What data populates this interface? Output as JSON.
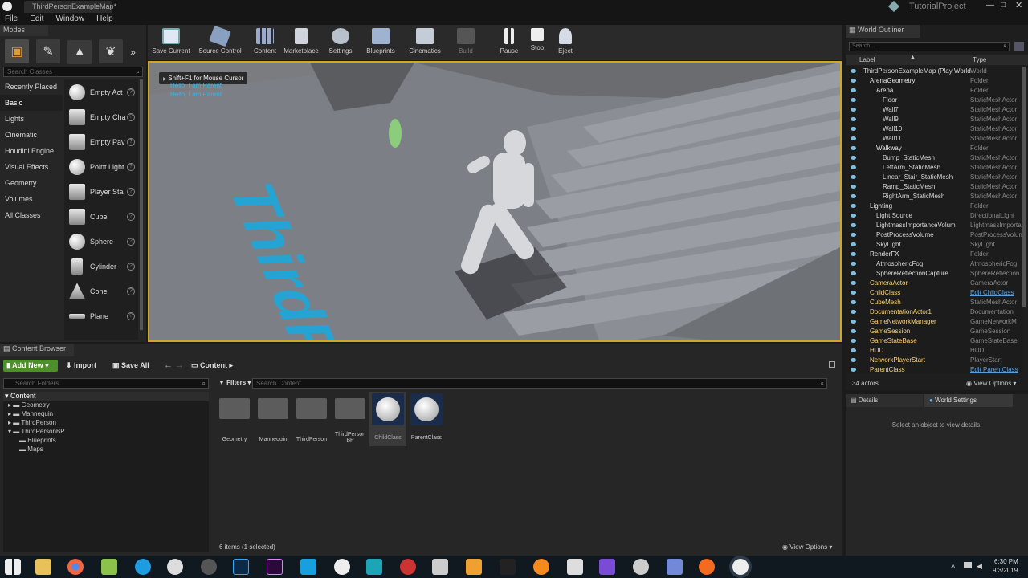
{
  "titlebar": {
    "tab_label": "ThirdPersonExampleMap*",
    "project_name": "TutorialProject"
  },
  "menu": [
    "File",
    "Edit",
    "Window",
    "Help"
  ],
  "modes": {
    "tab_label": "Modes",
    "search_placeholder": "Search Classes",
    "categories": [
      "Recently Placed",
      "Basic",
      "Lights",
      "Cinematic",
      "Houdini Engine",
      "Visual Effects",
      "Geometry",
      "Volumes",
      "All Classes"
    ],
    "selected_category": "Basic",
    "items": [
      "Empty Act",
      "Empty Cha",
      "Empty Pav",
      "Point Light",
      "Player Sta",
      "Cube",
      "Sphere",
      "Cylinder",
      "Cone",
      "Plane"
    ]
  },
  "toolbar": {
    "buttons": [
      "Save Current",
      "Source Control",
      "Content",
      "Marketplace",
      "Settings",
      "Blueprints",
      "Cinematics",
      "Build",
      "Pause",
      "Stop",
      "Eject"
    ]
  },
  "viewport": {
    "hint": "Shift+F1 for Mouse Cursor",
    "log_line_1": "Hello, I am Parent",
    "log_line_2": "Hello, I am Parent",
    "floor_text": "ThirdPerson"
  },
  "content_browser": {
    "tab_label": "Content Browser",
    "add_new": "Add New",
    "import": "Import",
    "save_all": "Save All",
    "path": "Content",
    "search_folders_placeholder": "Search Folders",
    "filters": "Filters",
    "search_content_placeholder": "Search Content",
    "tree": [
      "Content",
      "Geometry",
      "Mannequin",
      "ThirdPerson",
      "ThirdPersonBP",
      "Blueprints",
      "Maps"
    ],
    "assets": [
      "Geometry",
      "Mannequin",
      "ThirdPerson",
      "ThirdPerson BP",
      "ChildClass",
      "ParentClass"
    ],
    "status": "6 items (1 selected)",
    "view_options": "View Options"
  },
  "world_outliner": {
    "tab_label": "World Outliner",
    "search_placeholder": "Search...",
    "col_label": "Label",
    "col_type": "Type",
    "rows": [
      {
        "label": "ThirdPersonExampleMap (Play World",
        "type": "World",
        "indent": 0
      },
      {
        "label": "ArenaGeometry",
        "type": "Folder",
        "indent": 1
      },
      {
        "label": "Arena",
        "type": "Folder",
        "indent": 2
      },
      {
        "label": "Floor",
        "type": "StaticMeshActor",
        "indent": 3
      },
      {
        "label": "Wall7",
        "type": "StaticMeshActor",
        "indent": 3
      },
      {
        "label": "Wall9",
        "type": "StaticMeshActor",
        "indent": 3
      },
      {
        "label": "Wall10",
        "type": "StaticMeshActor",
        "indent": 3
      },
      {
        "label": "Wall11",
        "type": "StaticMeshActor",
        "indent": 3
      },
      {
        "label": "Walkway",
        "type": "Folder",
        "indent": 2
      },
      {
        "label": "Bump_StaticMesh",
        "type": "StaticMeshActor",
        "indent": 3
      },
      {
        "label": "LeftArm_StaticMesh",
        "type": "StaticMeshActor",
        "indent": 3
      },
      {
        "label": "Linear_Stair_StaticMesh",
        "type": "StaticMeshActor",
        "indent": 3
      },
      {
        "label": "Ramp_StaticMesh",
        "type": "StaticMeshActor",
        "indent": 3
      },
      {
        "label": "RightArm_StaticMesh",
        "type": "StaticMeshActor",
        "indent": 3
      },
      {
        "label": "Lighting",
        "type": "Folder",
        "indent": 1
      },
      {
        "label": "Light Source",
        "type": "DirectionalLight",
        "indent": 2
      },
      {
        "label": "LightmassImportanceVolum",
        "type": "LightmassImportance",
        "indent": 2
      },
      {
        "label": "PostProcessVolume",
        "type": "PostProcessVolume",
        "indent": 2
      },
      {
        "label": "SkyLight",
        "type": "SkyLight",
        "indent": 2
      },
      {
        "label": "RenderFX",
        "type": "Folder",
        "indent": 1
      },
      {
        "label": "AtmosphericFog",
        "type": "AtmosphericFog",
        "indent": 2
      },
      {
        "label": "SphereReflectionCapture",
        "type": "SphereReflection",
        "indent": 2
      },
      {
        "label": "CameraActor",
        "type": "CameraActor",
        "indent": 1
      },
      {
        "label": "ChildClass",
        "type": "Edit ChildClass",
        "indent": 1
      },
      {
        "label": "CubeMesh",
        "type": "StaticMeshActor",
        "indent": 1
      },
      {
        "label": "DocumentationActor1",
        "type": "Documentation",
        "indent": 1
      },
      {
        "label": "GameNetworkManager",
        "type": "GameNetworkM",
        "indent": 1
      },
      {
        "label": "GameSession",
        "type": "GameSession",
        "indent": 1
      },
      {
        "label": "GameStateBase",
        "type": "GameStateBase",
        "indent": 1
      },
      {
        "label": "HUD",
        "type": "HUD",
        "indent": 1
      },
      {
        "label": "NetworkPlayerStart",
        "type": "PlayerStart",
        "indent": 1
      },
      {
        "label": "ParentClass",
        "type": "Edit ParentClass",
        "indent": 1
      }
    ],
    "actor_count": "34 actors",
    "view_options": "View Options"
  },
  "details": {
    "tab_details": "Details",
    "tab_world_settings": "World Settings",
    "empty_msg": "Select an object to view details."
  },
  "taskbar": {
    "time": "6:30 PM",
    "date": "9/3/2019"
  },
  "colors": {
    "accent": "#d4a81e",
    "add_new_green": "#4d8f2a",
    "folder_text": "#ffd27a",
    "link_blue": "#5aa0e0"
  }
}
